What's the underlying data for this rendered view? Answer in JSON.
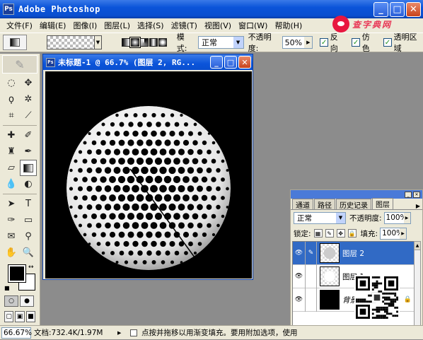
{
  "app": {
    "title": "Adobe Photoshop",
    "icon_label": "Ps"
  },
  "window_buttons": {
    "minimize": "_",
    "maximize": "□",
    "close": "✕"
  },
  "menu": [
    "文件(F)",
    "编辑(E)",
    "图像(I)",
    "图层(L)",
    "选择(S)",
    "滤镜(T)",
    "视图(V)",
    "窗口(W)",
    "帮助(H)"
  ],
  "options": {
    "mode_label": "模式:",
    "mode_value": "正常",
    "opacity_label": "不透明度:",
    "opacity_value": "50%",
    "reverse_label": "反向",
    "dither_label": "仿色",
    "transparency_label": "透明区域",
    "check_mark": "✓"
  },
  "document": {
    "title": "未标题-1 @ 66.7% (图层 2, RG...",
    "background_color": "#000000",
    "sphere_pattern": "halftone-dot-sphere"
  },
  "layers_panel": {
    "tabs": [
      "通道",
      "路径",
      "历史记录",
      "图层"
    ],
    "active_tab": "图层",
    "blend_mode": "正常",
    "opacity_label": "不透明度:",
    "opacity_value": "100%",
    "lock_label": "锁定:",
    "fill_label": "填充:",
    "fill_value": "100%",
    "layers": [
      {
        "name": "图层 2",
        "selected": true
      },
      {
        "name": "图层 1",
        "selected": false
      },
      {
        "name": "背景",
        "selected": false
      }
    ]
  },
  "status": {
    "zoom": "66.67%",
    "doc_size": "文档:732.4K/1.97M",
    "hint": "点按并拖移以用渐变填充。要用附加选项，使用"
  },
  "watermark": {
    "text": "查字典网",
    "qr_alt": "qr-code"
  },
  "colors": {
    "foreground": "#000000",
    "background": "#ffffff",
    "selected_layer": "#316ac5",
    "titlebar": "#0b54d9"
  }
}
